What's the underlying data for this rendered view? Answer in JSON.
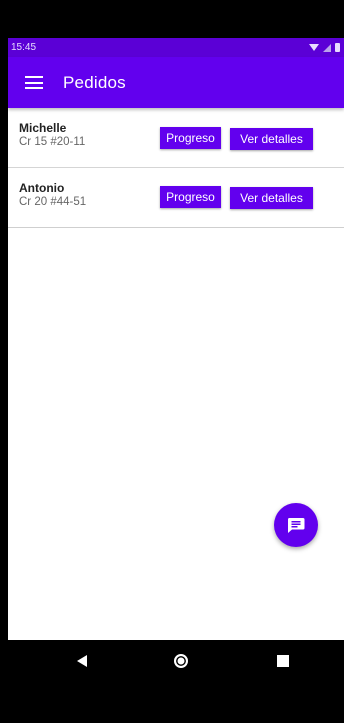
{
  "status_bar": {
    "time": "15:45"
  },
  "app_bar": {
    "title": "Pedidos",
    "menu_icon": "menu-icon"
  },
  "orders": [
    {
      "name": "Michelle",
      "address": "Cr 15 #20-11",
      "progress_label": "Progreso",
      "details_label": "Ver detalles"
    },
    {
      "name": "Antonio",
      "address": "Cr 20 #44-51",
      "progress_label": "Progreso",
      "details_label": "Ver detalles"
    }
  ],
  "fab": {
    "icon": "message-icon"
  },
  "nav_bar": {
    "back_icon": "back-icon",
    "home_icon": "home-icon",
    "recent_icon": "recent-apps-icon"
  },
  "colors": {
    "primary": "#6200ee",
    "primary_dark": "#5b00d6",
    "background": "#ffffff"
  }
}
